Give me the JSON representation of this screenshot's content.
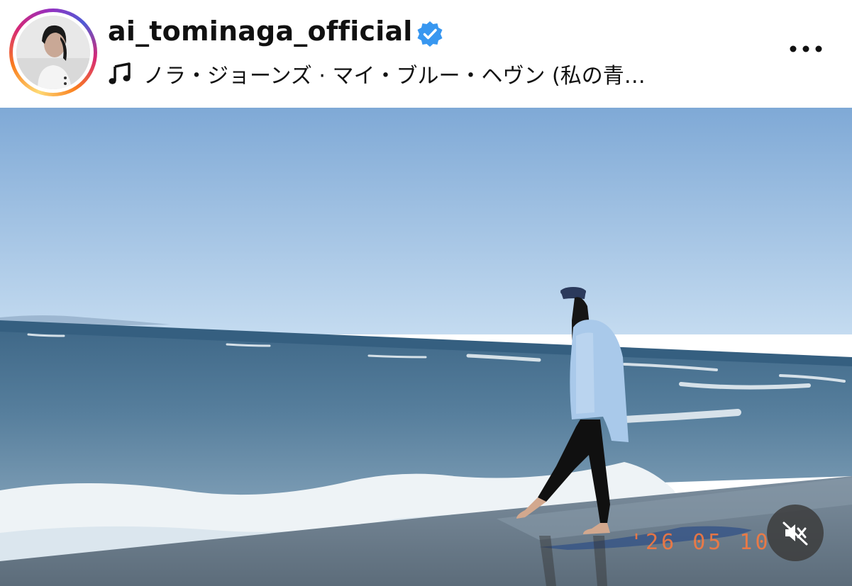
{
  "post": {
    "username": "ai_tominaga_official",
    "verified": true,
    "music_label": "ノラ・ジョーンズ · マイ・ブルー・ヘヴン (私の青…",
    "date_stamp": "'26 05 10"
  },
  "icons": {
    "avatar": "avatar-story-ring",
    "verified": "verified-badge-icon",
    "music": "music-note-icon",
    "more": "more-options-icon",
    "mute": "muted-speaker-icon"
  },
  "colors": {
    "verified_blue": "#3897f0",
    "date_stamp_orange": "#ff7a3c",
    "sky_top": "#7fa9d6",
    "sky_bottom": "#c4dbf0"
  }
}
